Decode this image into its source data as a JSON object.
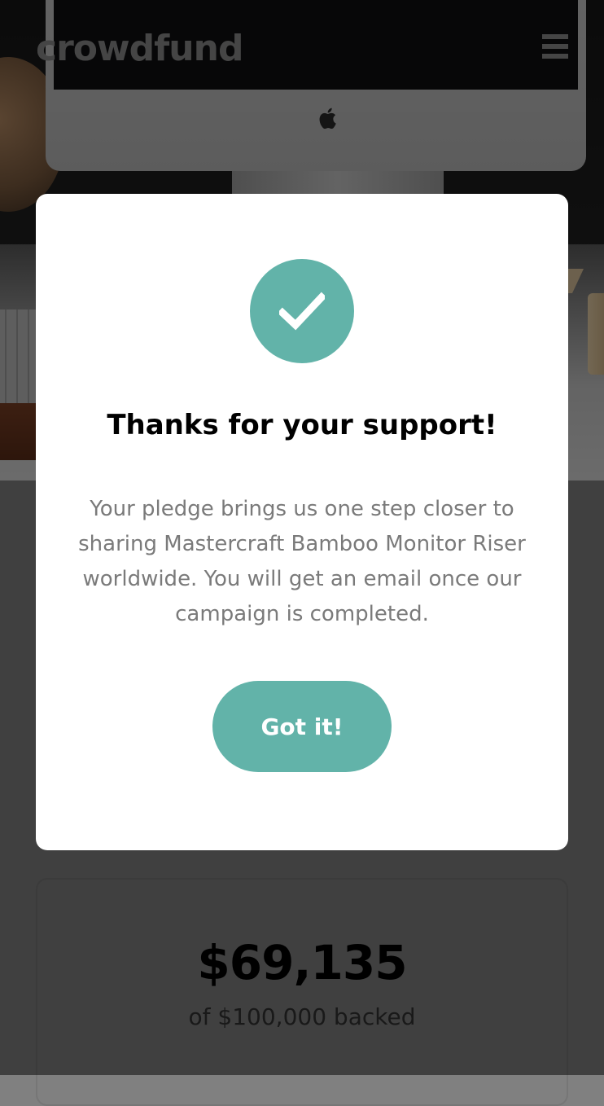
{
  "header": {
    "logo_text": "crowdfund",
    "menu_icon": "hamburger-menu-icon"
  },
  "hero": {
    "image_description_icon": "desk-setup-photo"
  },
  "modal": {
    "icon": "check-icon",
    "title": "Thanks for your support!",
    "body": "Your pledge brings us one step closer to sharing Mastercraft Bamboo Monitor Riser worldwide. You will get an email once our campaign is completed.",
    "button_label": "Got it!"
  },
  "stats": {
    "amount": "$69,135",
    "caption": "of $100,000 backed"
  },
  "colors": {
    "accent": "#62b3a9",
    "overlay": "rgba(0,0,0,0.5)",
    "modal_background": "#ffffff"
  }
}
